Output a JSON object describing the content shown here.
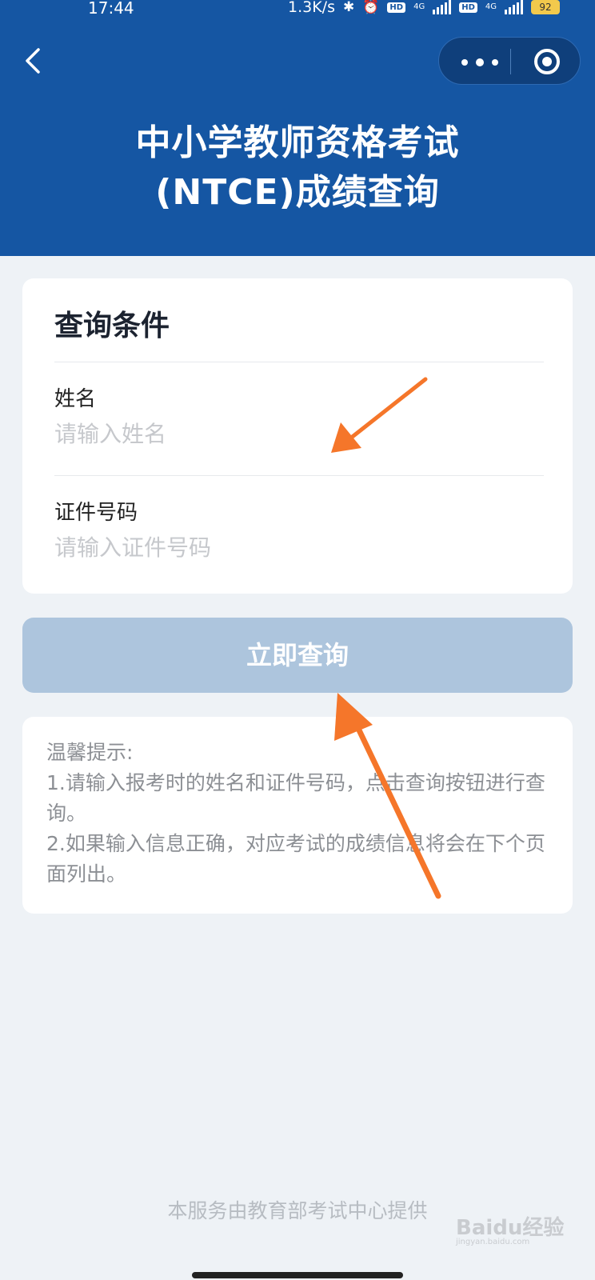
{
  "status_bar": {
    "time": "17:44",
    "net_speed": "1.3K/s",
    "hd_badge": "HD",
    "network": "4G",
    "battery": "92",
    "icons": [
      "bluetooth-icon",
      "alarm-icon",
      "signal-icon",
      "battery-icon"
    ]
  },
  "header": {
    "title_line1": "中小学教师资格考试",
    "title_line2": "(NTCE)成绩查询",
    "background": "#1556a3"
  },
  "query_card": {
    "title": "查询条件",
    "name_label": "姓名",
    "name_placeholder": "请输入姓名",
    "id_label": "证件号码",
    "id_placeholder": "请输入证件号码"
  },
  "submit_button": {
    "label": "立即查询",
    "color": "#adc5dd"
  },
  "tips": {
    "heading": "温馨提示:",
    "line1": "1.请输入报考时的姓名和证件号码，点击查询按钮进行查询。",
    "line2": "2.如果输入信息正确，对应考试的成绩信息将会在下个页面列出。"
  },
  "footer": {
    "text": "本服务由教育部考试中心提供"
  },
  "watermark": {
    "brand": "Baidu经验",
    "url": "jingyan.baidu.com"
  },
  "annotation_color": "#f5762a"
}
